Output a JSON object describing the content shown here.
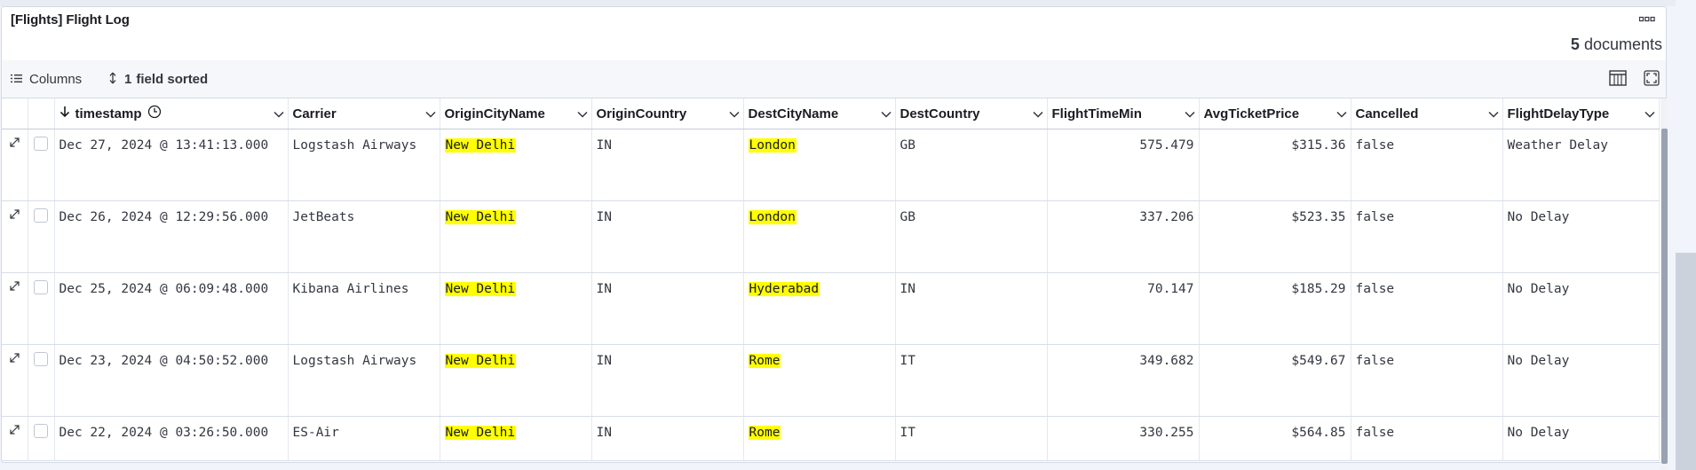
{
  "panel": {
    "title": "[Flights] Flight Log"
  },
  "summary": {
    "count": "5",
    "count_label": "documents"
  },
  "toolbar": {
    "columns_label": "Columns",
    "sort_count": "1",
    "sort_label": "field sorted"
  },
  "columns": [
    {
      "key": "timestamp",
      "label": "timestamp"
    },
    {
      "key": "carrier",
      "label": "Carrier"
    },
    {
      "key": "origin_city",
      "label": "OriginCityName"
    },
    {
      "key": "origin_country",
      "label": "OriginCountry"
    },
    {
      "key": "dest_city",
      "label": "DestCityName"
    },
    {
      "key": "dest_country",
      "label": "DestCountry"
    },
    {
      "key": "flight_time",
      "label": "FlightTimeMin"
    },
    {
      "key": "price",
      "label": "AvgTicketPrice"
    },
    {
      "key": "cancelled",
      "label": "Cancelled"
    },
    {
      "key": "delay_type",
      "label": "FlightDelayType"
    }
  ],
  "rows": [
    {
      "timestamp": "Dec 27, 2024 @ 13:41:13.000",
      "carrier": "Logstash Airways",
      "origin_city": "New Delhi",
      "origin_country": "IN",
      "dest_city": "London",
      "dest_country": "GB",
      "flight_time": "575.479",
      "price": "$315.36",
      "cancelled": "false",
      "delay_type": "Weather Delay"
    },
    {
      "timestamp": "Dec 26, 2024 @ 12:29:56.000",
      "carrier": "JetBeats",
      "origin_city": "New Delhi",
      "origin_country": "IN",
      "dest_city": "London",
      "dest_country": "GB",
      "flight_time": "337.206",
      "price": "$523.35",
      "cancelled": "false",
      "delay_type": "No Delay"
    },
    {
      "timestamp": "Dec 25, 2024 @ 06:09:48.000",
      "carrier": "Kibana Airlines",
      "origin_city": "New Delhi",
      "origin_country": "IN",
      "dest_city": "Hyderabad",
      "dest_country": "IN",
      "flight_time": "70.147",
      "price": "$185.29",
      "cancelled": "false",
      "delay_type": "No Delay"
    },
    {
      "timestamp": "Dec 23, 2024 @ 04:50:52.000",
      "carrier": "Logstash Airways",
      "origin_city": "New Delhi",
      "origin_country": "IN",
      "dest_city": "Rome",
      "dest_country": "IT",
      "flight_time": "349.682",
      "price": "$549.67",
      "cancelled": "false",
      "delay_type": "No Delay"
    },
    {
      "timestamp": "Dec 22, 2024 @ 03:26:50.000",
      "carrier": "ES-Air",
      "origin_city": "New Delhi",
      "origin_country": "IN",
      "dest_city": "Rome",
      "dest_country": "IT",
      "flight_time": "330.255",
      "price": "$564.85",
      "cancelled": "false",
      "delay_type": "No Delay"
    }
  ],
  "icons": {
    "panel_menu": "ellipsis-icon",
    "columns": "list-icon",
    "sort": "sort-arrows-icon",
    "sort_direction": "arrow-down-icon",
    "time_field": "clock-icon",
    "density": "table-density-icon",
    "fullscreen": "fullscreen-icon",
    "expand": "expand-row-icon"
  },
  "colors": {
    "highlight": "#ffff00",
    "text": "#343741",
    "border": "#d3dae6"
  }
}
